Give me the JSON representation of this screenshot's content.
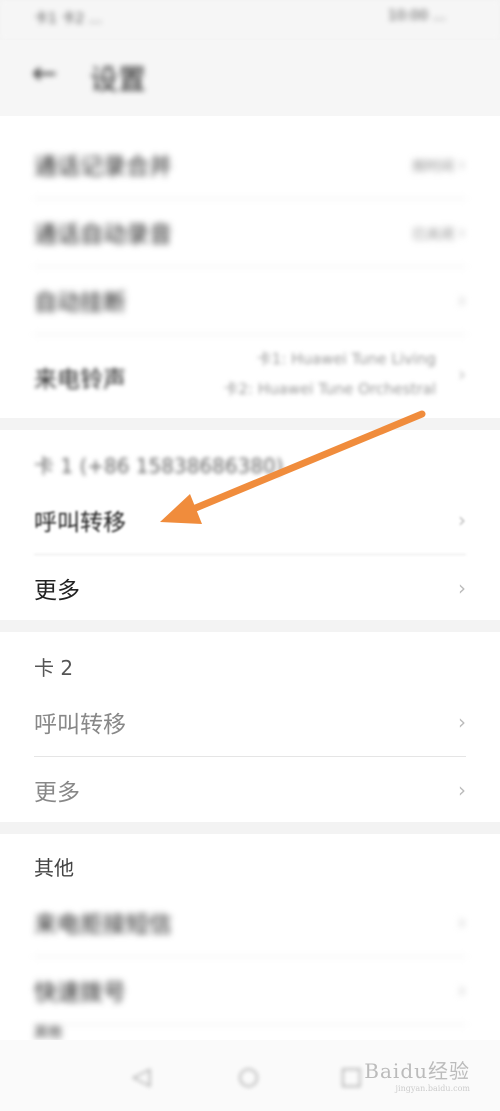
{
  "status_bar": {
    "left": "卡1 卡2 ...",
    "right": "10:00 ..."
  },
  "header": {
    "title": "设置"
  },
  "general": {
    "rows": [
      {
        "label": "通话记录合并",
        "value": "按时间"
      },
      {
        "label": "通话自动录音",
        "value": "已关闭"
      },
      {
        "label": "自动挂断",
        "value": ""
      }
    ],
    "ringtone": {
      "label": "来电铃声",
      "sim1": "卡1: Huawei Tune Living",
      "sim2": "卡2: Huawei Tune Orchestral"
    }
  },
  "card1": {
    "title": "卡 1 (+86 15838686380)",
    "forwarding": "呼叫转移",
    "more": "更多"
  },
  "card2": {
    "title": "卡 2",
    "forwarding": "呼叫转移",
    "more": "更多"
  },
  "other": {
    "title": "其他",
    "rows": [
      {
        "label": "来电拒接短信"
      },
      {
        "label": "快速拨号"
      },
      {
        "label": "其他"
      }
    ]
  },
  "watermark": {
    "main": "Baidu经验",
    "sub": "jingyan.baidu.com"
  },
  "colors": {
    "arrow": "#f08c3c",
    "background": "#f3f3f3"
  },
  "icons": [
    "back-icon",
    "chevron-right-icon",
    "nav-back-icon",
    "nav-home-icon",
    "nav-recent-icon"
  ]
}
